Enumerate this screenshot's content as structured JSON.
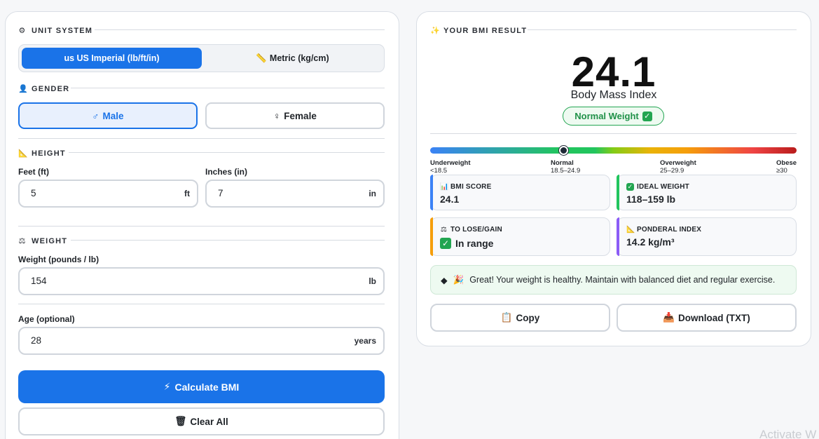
{
  "form": {
    "unit_system": {
      "title": "UNIT SYSTEM",
      "icon": "settings-icon",
      "imperial_label": "us US Imperial (lb/ft/in)",
      "metric_label": "Metric (kg/cm)",
      "metric_icon": "ruler-icon",
      "selected": "imperial"
    },
    "gender": {
      "title": "GENDER",
      "icon": "person-icon",
      "male_label": "Male",
      "female_label": "Female",
      "selected": "male"
    },
    "height": {
      "title": "HEIGHT",
      "icon": "triangle-ruler-icon",
      "feet_label": "Feet (ft)",
      "feet_value": "5",
      "feet_unit": "ft",
      "inches_label": "Inches (in)",
      "inches_value": "7",
      "inches_unit": "in"
    },
    "weight": {
      "title": "WEIGHT",
      "icon": "scale-icon",
      "label": "Weight (pounds / lb)",
      "value": "154",
      "unit": "lb"
    },
    "age": {
      "label": "Age (optional)",
      "value": "28",
      "unit": "years"
    },
    "calculate_label": "Calculate BMI",
    "clear_label": "Clear All"
  },
  "result": {
    "title": "YOUR BMI RESULT",
    "bmi": "24.1",
    "bmi_numeric": 24.1,
    "caption": "Body Mass Index",
    "category": "Normal Weight",
    "scale": {
      "min": 15,
      "max": 40,
      "labels": [
        {
          "name": "Underweight",
          "range": "<18.5"
        },
        {
          "name": "Normal",
          "range": "18.5–24.9"
        },
        {
          "name": "Overweight",
          "range": "25–29.9"
        },
        {
          "name": "Obese",
          "range": "≥30"
        }
      ]
    },
    "stats": {
      "bmi_score_label": "BMI SCORE",
      "bmi_score_value": "24.1",
      "ideal_weight_label": "IDEAL WEIGHT",
      "ideal_weight_value": "118–159 lb",
      "lose_gain_label": "TO LOSE/GAIN",
      "lose_gain_value": "In range",
      "ponderal_label": "PONDERAL INDEX",
      "ponderal_value": "14.2 kg/m³"
    },
    "advice": "Great! Your weight is healthy. Maintain with balanced diet and regular exercise.",
    "copy_label": "Copy",
    "download_label": "Download (TXT)"
  },
  "watermark": "Activate W",
  "colors": {
    "primary": "#1a73e8",
    "success": "#22a551",
    "bmi_accent": "#3b82f6",
    "ideal_accent": "#22c55e",
    "lose_accent": "#f59e0b",
    "ponderal_accent": "#8b5cf6"
  }
}
